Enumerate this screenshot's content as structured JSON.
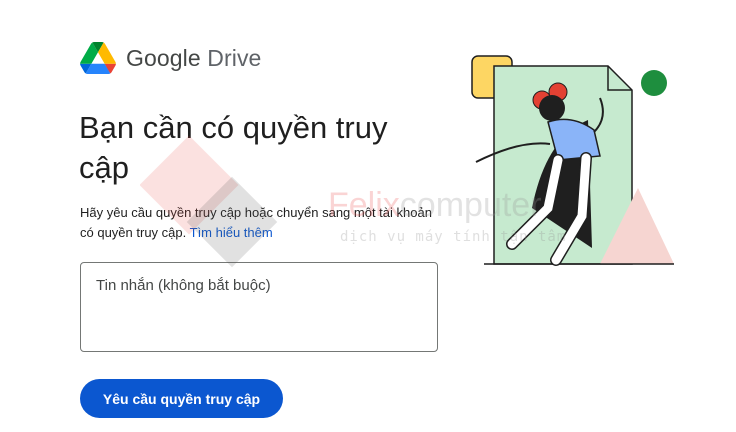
{
  "brand": {
    "name_part1": "Google",
    "name_part2": "Drive"
  },
  "page": {
    "title": "Bạn cần có quyền truy cập",
    "description": "Hãy yêu cầu quyền truy cập hoặc chuyển sang một tài khoản có quyền truy cập.",
    "learn_more_link": "Tìm hiểu thêm"
  },
  "form": {
    "message_placeholder": "Tin nhắn (không bắt buộc)",
    "message_value": "",
    "request_button": "Yêu cầu quyền truy cập"
  },
  "watermark": {
    "brand_part1": "Felix",
    "brand_part2": "computer",
    "tagline": "dịch vụ máy tính tận tâm"
  },
  "colors": {
    "primary": "#0b57d0",
    "illustration_doc": "#c6eacf",
    "illustration_accent_red": "#e34133",
    "illustration_accent_green": "#1e8e3e",
    "illustration_accent_yellow": "#fdd663"
  },
  "icons": {
    "logo": "google-drive-logo-icon",
    "illustration": "access-denied-illustration"
  }
}
